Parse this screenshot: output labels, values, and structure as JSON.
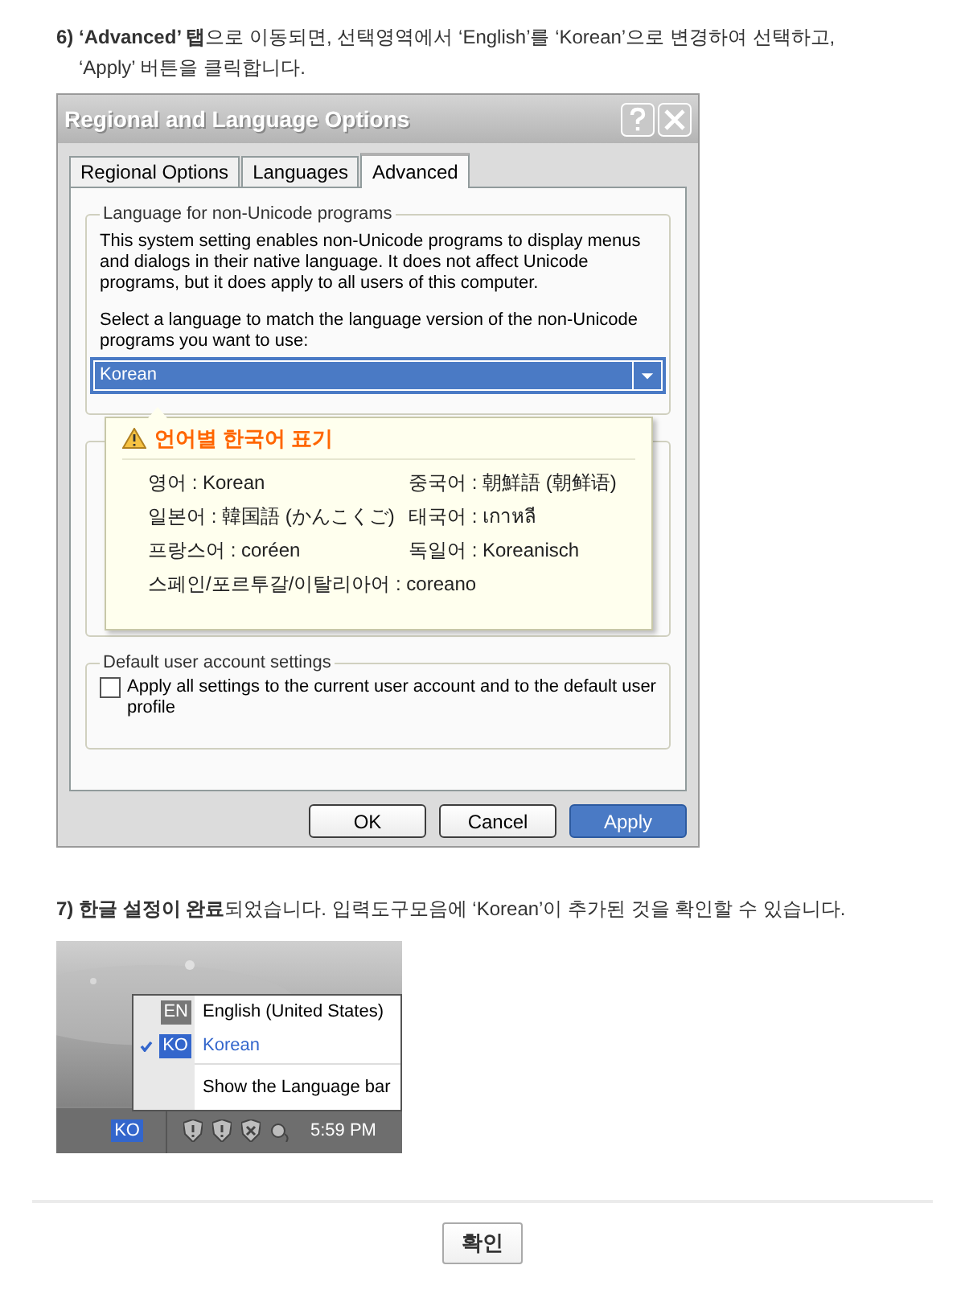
{
  "steps": [
    {
      "text": "**6) ‘Advanced’ 탭**으로 이동되면, 선택영역에서 ‘English’를 ‘Korean’으로 변경하여 선택하고, ‘Apply’ 버튼을 클릭합니다."
    },
    {
      "text": "**7) 한글 설정이 완료**되었습니다. 입력도구모음에 ‘Korean’이 추가된 것을 확인할 수 있습니다."
    }
  ],
  "dialog": {
    "title": "Regional and Language Options",
    "tabs": [
      {
        "label": "Regional Options",
        "selected": false
      },
      {
        "label": "Languages",
        "selected": false
      },
      {
        "label": "Advanced",
        "selected": true
      }
    ],
    "unicode_group": {
      "legend": "Language for non-Unicode programs",
      "description": "This system setting enables non-Unicode programs to display menus and dialogs in their native language. It does not affect Unicode programs, but it does apply to all users of this computer.",
      "prompt": "Select a language to match the language version of the non-Unicode programs you want to use:",
      "value": "Korean"
    },
    "tooltip": {
      "title": "언어별 한국어 표기",
      "entries": [
        {
          "text": "영어 : Korean",
          "kind": "half"
        },
        {
          "text": "중국어 : 朝鮮語 (朝鲜语)",
          "kind": "half"
        },
        {
          "text": "일본어 : 韓国語 (かんこくご)",
          "kind": "half"
        },
        {
          "text": "태국어 : เกาหลี",
          "kind": "half"
        },
        {
          "text": "프랑스어 : coréen",
          "kind": "half"
        },
        {
          "text": "독일어 : Koreanisch",
          "kind": "half"
        },
        {
          "text": "스페인/포르투갈/이탈리아어 : coreano",
          "kind": "full"
        }
      ]
    },
    "account_group": {
      "legend": "Default user account settings",
      "checkbox_label": "Apply all settings to the current user account and to the default user profile",
      "checked": false
    },
    "buttons": [
      {
        "label": "OK",
        "kind": "normal"
      },
      {
        "label": "Cancel",
        "kind": "normal"
      },
      {
        "label": "Apply",
        "kind": "primary"
      }
    ]
  },
  "taskbar": {
    "menu": [
      {
        "code": "EN",
        "label": "English (United States)",
        "selected": false
      },
      {
        "code": "KO",
        "label": "Korean",
        "selected": true
      }
    ],
    "menu_footer": "Show the Language bar",
    "indicator": "KO",
    "clock": "5:59 PM"
  },
  "confirm_button": "확인"
}
